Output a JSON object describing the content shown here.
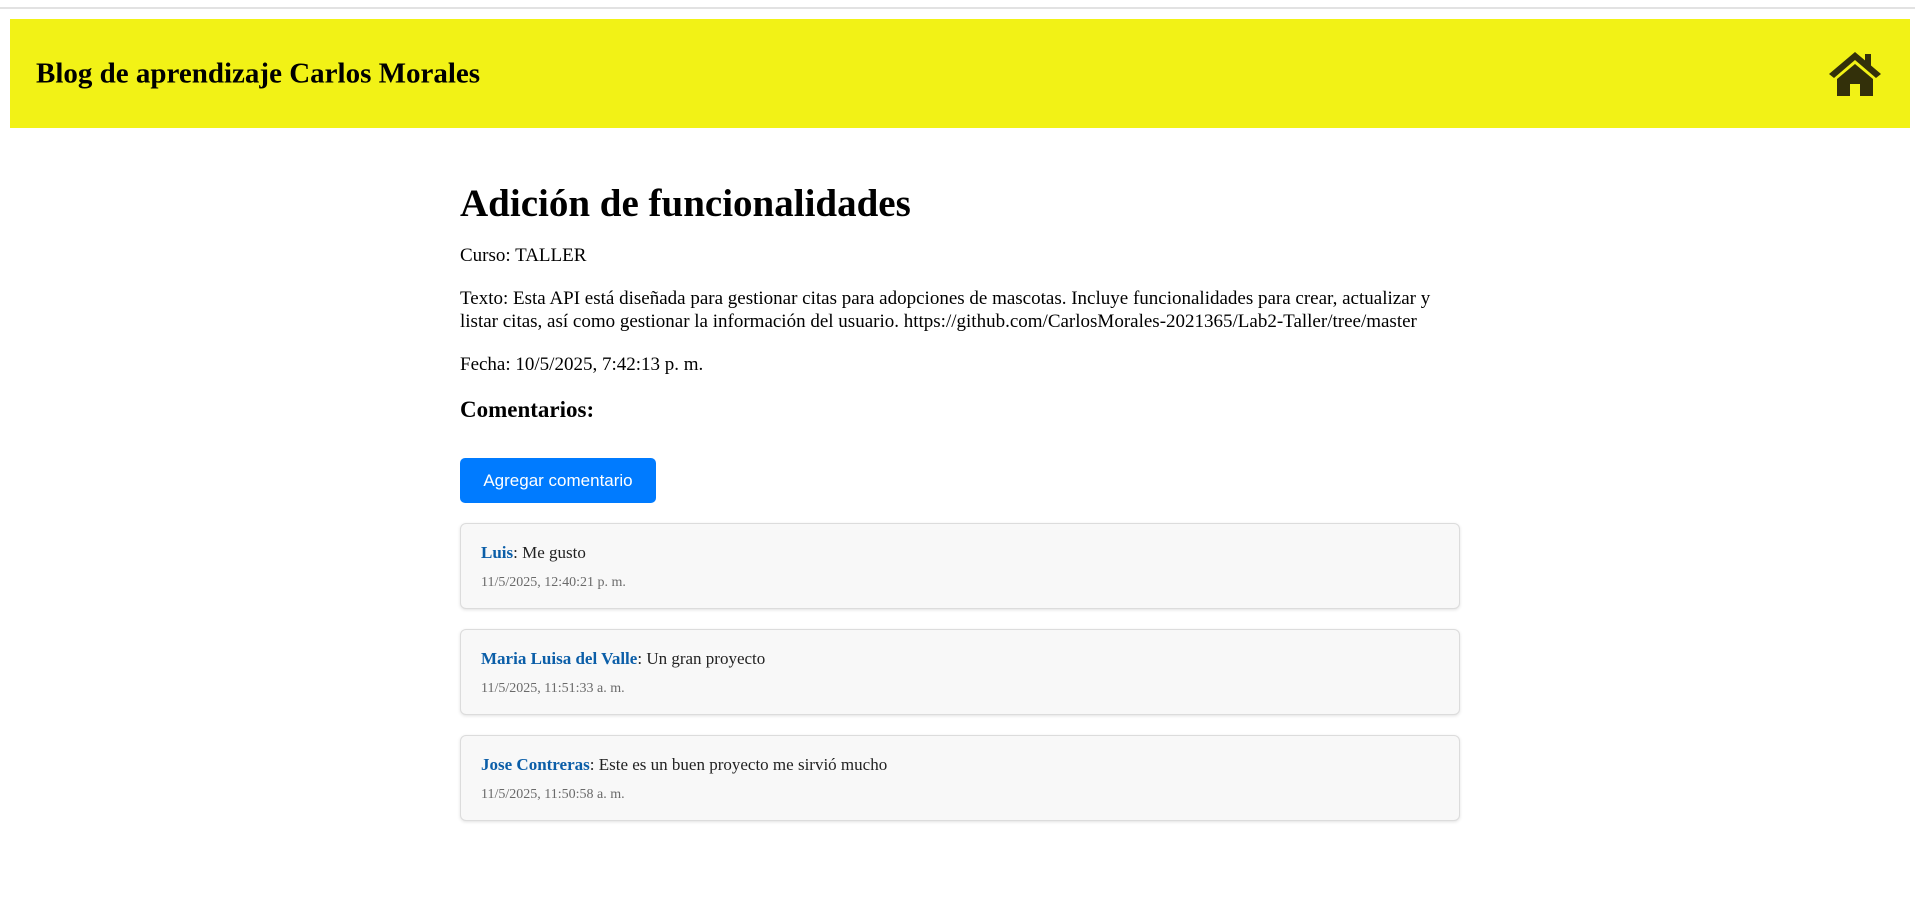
{
  "header": {
    "title": "Blog de aprendizaje Carlos Morales",
    "home_icon": "home-icon",
    "background_color": "#f2f216"
  },
  "post": {
    "title": "Adición de funcionalidades",
    "curso_label": "Curso:",
    "curso": "TALLER",
    "texto_label": "Texto:",
    "texto": "Esta API está diseñada para gestionar citas para adopciones de mascotas. Incluye funcionalidades para crear, actualizar y listar citas, así como gestionar la información del usuario. https://github.com/CarlosMorales-2021365/Lab2-Taller/tree/master",
    "fecha_label": "Fecha:",
    "fecha": "10/5/2025, 7:42:13 p. m."
  },
  "comments_section": {
    "heading": "Comentarios:",
    "add_button_label": "Agregar comentario",
    "button_color": "#007bff",
    "author_color": "#0b5ea8",
    "items": [
      {
        "author": "Luis",
        "separator": ":",
        "text": "Me gusto",
        "date": "11/5/2025, 12:40:21 p. m."
      },
      {
        "author": "Maria Luisa del Valle",
        "separator": ":",
        "text": "Un gran proyecto",
        "date": "11/5/2025, 11:51:33 a. m."
      },
      {
        "author": "Jose Contreras",
        "separator": ":",
        "text": "Este es un buen proyecto me sirvió mucho",
        "date": "11/5/2025, 11:50:58 a. m."
      }
    ]
  }
}
